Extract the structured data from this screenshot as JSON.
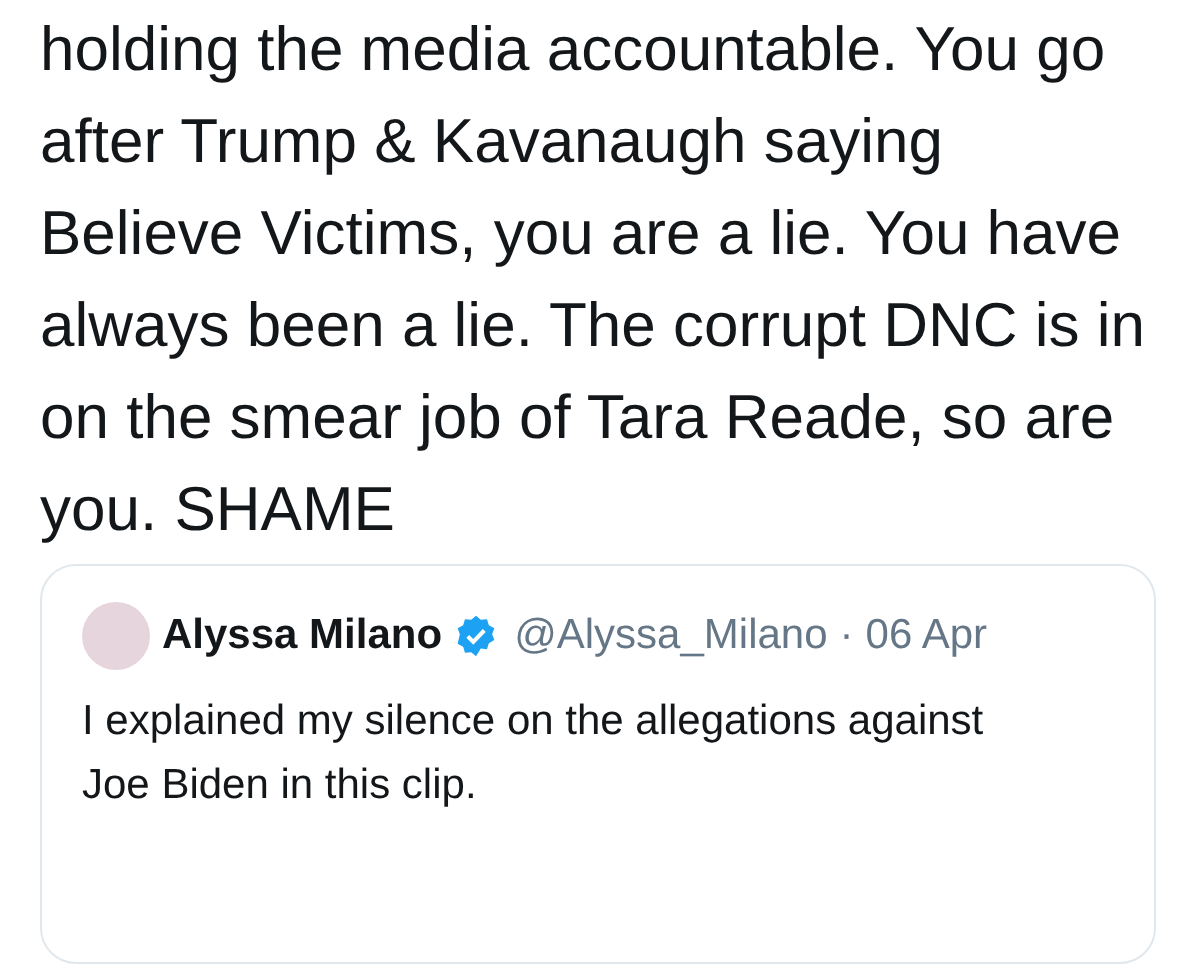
{
  "tweet": {
    "text": "holding the media accountable. You go after Trump & Kavanaugh saying Believe Victims, you are a lie. You have always been a lie. The corrupt DNC is in on the smear job of Tara Reade, so are you. SHAME"
  },
  "quoted_tweet": {
    "name": "Alyssa Milano",
    "verified": true,
    "handle": "@Alyssa_Milano",
    "separator": "·",
    "date": "06 Apr",
    "text": "I explained my silence on the allegations against Joe Biden in this clip."
  }
}
